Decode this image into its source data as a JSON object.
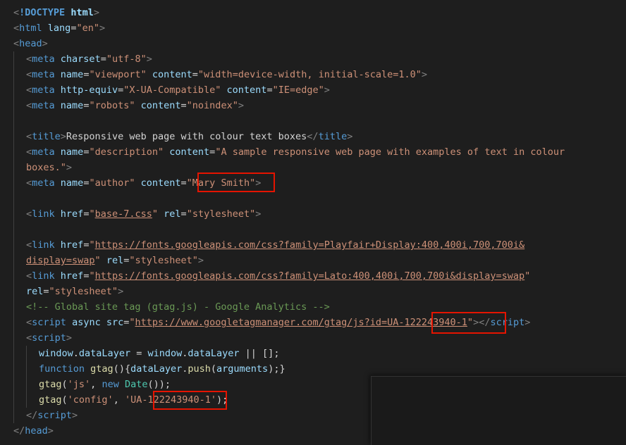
{
  "code": {
    "lines": [
      {
        "indent": 0,
        "tokens": [
          [
            "punc",
            "<"
          ],
          [
            "tag bold",
            "!DOCTYPE"
          ],
          [
            "txt",
            " "
          ],
          [
            "attr bold",
            "html"
          ],
          [
            "punc",
            ">"
          ]
        ]
      },
      {
        "indent": 0,
        "tokens": [
          [
            "punc",
            "<"
          ],
          [
            "tag",
            "html"
          ],
          [
            "txt",
            " "
          ],
          [
            "attr",
            "lang"
          ],
          [
            "txt",
            "="
          ],
          [
            "str",
            "\"en\""
          ],
          [
            "punc",
            ">"
          ]
        ]
      },
      {
        "indent": 0,
        "tokens": [
          [
            "punc",
            "<"
          ],
          [
            "tag",
            "head"
          ],
          [
            "punc",
            ">"
          ]
        ]
      },
      {
        "indent": 1,
        "tokens": [
          [
            "punc",
            "<"
          ],
          [
            "tag",
            "meta"
          ],
          [
            "txt",
            " "
          ],
          [
            "attr",
            "charset"
          ],
          [
            "txt",
            "="
          ],
          [
            "str",
            "\"utf-8\""
          ],
          [
            "punc",
            ">"
          ]
        ]
      },
      {
        "indent": 1,
        "tokens": [
          [
            "punc",
            "<"
          ],
          [
            "tag",
            "meta"
          ],
          [
            "txt",
            " "
          ],
          [
            "attr",
            "name"
          ],
          [
            "txt",
            "="
          ],
          [
            "str",
            "\"viewport\""
          ],
          [
            "txt",
            " "
          ],
          [
            "attr",
            "content"
          ],
          [
            "txt",
            "="
          ],
          [
            "str",
            "\"width=device-width, initial-scale=1.0\""
          ],
          [
            "punc",
            ">"
          ]
        ]
      },
      {
        "indent": 1,
        "tokens": [
          [
            "punc",
            "<"
          ],
          [
            "tag",
            "meta"
          ],
          [
            "txt",
            " "
          ],
          [
            "attr",
            "http-equiv"
          ],
          [
            "txt",
            "="
          ],
          [
            "str",
            "\"X-UA-Compatible\""
          ],
          [
            "txt",
            " "
          ],
          [
            "attr",
            "content"
          ],
          [
            "txt",
            "="
          ],
          [
            "str",
            "\"IE=edge\""
          ],
          [
            "punc",
            ">"
          ]
        ]
      },
      {
        "indent": 1,
        "tokens": [
          [
            "punc",
            "<"
          ],
          [
            "tag",
            "meta"
          ],
          [
            "txt",
            " "
          ],
          [
            "attr",
            "name"
          ],
          [
            "txt",
            "="
          ],
          [
            "str",
            "\"robots\""
          ],
          [
            "txt",
            " "
          ],
          [
            "attr",
            "content"
          ],
          [
            "txt",
            "="
          ],
          [
            "str",
            "\"noindex\""
          ],
          [
            "punc",
            ">"
          ]
        ]
      },
      {
        "indent": 1,
        "tokens": []
      },
      {
        "indent": 1,
        "tokens": [
          [
            "punc",
            "<"
          ],
          [
            "tag",
            "title"
          ],
          [
            "punc",
            ">"
          ],
          [
            "txt",
            "Responsive web page with colour text boxes"
          ],
          [
            "punc",
            "</"
          ],
          [
            "tag",
            "title"
          ],
          [
            "punc",
            ">"
          ]
        ]
      },
      {
        "indent": 1,
        "tokens": [
          [
            "punc",
            "<"
          ],
          [
            "tag",
            "meta"
          ],
          [
            "txt",
            " "
          ],
          [
            "attr",
            "name"
          ],
          [
            "txt",
            "="
          ],
          [
            "str",
            "\"description\""
          ],
          [
            "txt",
            " "
          ],
          [
            "attr",
            "content"
          ],
          [
            "txt",
            "="
          ],
          [
            "str",
            "\"A sample responsive web page with examples of text in colour"
          ]
        ]
      },
      {
        "indent": 1,
        "tokens": [
          [
            "str",
            "boxes.\""
          ],
          [
            "punc",
            ">"
          ]
        ]
      },
      {
        "indent": 1,
        "tokens": [
          [
            "punc",
            "<"
          ],
          [
            "tag",
            "meta"
          ],
          [
            "txt",
            " "
          ],
          [
            "attr",
            "name"
          ],
          [
            "txt",
            "="
          ],
          [
            "str",
            "\"author\""
          ],
          [
            "txt",
            " "
          ],
          [
            "attr",
            "content"
          ],
          [
            "txt",
            "="
          ],
          [
            "str",
            "\"Mary Smith\""
          ],
          [
            "punc",
            ">"
          ]
        ]
      },
      {
        "indent": 1,
        "tokens": []
      },
      {
        "indent": 1,
        "tokens": [
          [
            "punc",
            "<"
          ],
          [
            "tag",
            "link"
          ],
          [
            "txt",
            " "
          ],
          [
            "attr",
            "href"
          ],
          [
            "txt",
            "="
          ],
          [
            "str",
            "\""
          ],
          [
            "str link",
            "base-7.css"
          ],
          [
            "str",
            "\""
          ],
          [
            "txt",
            " "
          ],
          [
            "attr",
            "rel"
          ],
          [
            "txt",
            "="
          ],
          [
            "str",
            "\"stylesheet\""
          ],
          [
            "punc",
            ">"
          ]
        ]
      },
      {
        "indent": 1,
        "tokens": []
      },
      {
        "indent": 1,
        "tokens": [
          [
            "punc",
            "<"
          ],
          [
            "tag",
            "link"
          ],
          [
            "txt",
            " "
          ],
          [
            "attr",
            "href"
          ],
          [
            "txt",
            "="
          ],
          [
            "str",
            "\""
          ],
          [
            "str link",
            "https://fonts.googleapis.com/css?family=Playfair+Display:400,400i,700,700i&"
          ]
        ]
      },
      {
        "indent": 1,
        "tokens": [
          [
            "str link",
            "display=swap"
          ],
          [
            "str",
            "\""
          ],
          [
            "txt",
            " "
          ],
          [
            "attr",
            "rel"
          ],
          [
            "txt",
            "="
          ],
          [
            "str",
            "\"stylesheet\""
          ],
          [
            "punc",
            ">"
          ]
        ]
      },
      {
        "indent": 1,
        "tokens": [
          [
            "punc",
            "<"
          ],
          [
            "tag",
            "link"
          ],
          [
            "txt",
            " "
          ],
          [
            "attr",
            "href"
          ],
          [
            "txt",
            "="
          ],
          [
            "str",
            "\""
          ],
          [
            "str link",
            "https://fonts.googleapis.com/css?family=Lato:400,400i,700,700i&display=swap"
          ],
          [
            "str",
            "\""
          ]
        ]
      },
      {
        "indent": 1,
        "tokens": [
          [
            "attr",
            "rel"
          ],
          [
            "txt",
            "="
          ],
          [
            "str",
            "\"stylesheet\""
          ],
          [
            "punc",
            ">"
          ]
        ]
      },
      {
        "indent": 1,
        "tokens": [
          [
            "com",
            "<!-- Global site tag (gtag.js) - Google Analytics -->"
          ]
        ]
      },
      {
        "indent": 1,
        "tokens": [
          [
            "punc",
            "<"
          ],
          [
            "tag",
            "script"
          ],
          [
            "txt",
            " "
          ],
          [
            "attr",
            "async"
          ],
          [
            "txt",
            " "
          ],
          [
            "attr",
            "src"
          ],
          [
            "txt",
            "="
          ],
          [
            "str",
            "\""
          ],
          [
            "str link",
            "https://www.googletagmanager.com/gtag/js?id=UA-122243940-1"
          ],
          [
            "str",
            "\""
          ],
          [
            "punc",
            "></"
          ],
          [
            "tag",
            "script"
          ],
          [
            "punc",
            ">"
          ]
        ]
      },
      {
        "indent": 1,
        "tokens": [
          [
            "punc",
            "<"
          ],
          [
            "tag",
            "script"
          ],
          [
            "punc",
            ">"
          ]
        ]
      },
      {
        "indent": 2,
        "tokens": [
          [
            "var",
            "window"
          ],
          [
            "txt",
            "."
          ],
          [
            "var",
            "dataLayer"
          ],
          [
            "txt",
            " = "
          ],
          [
            "var",
            "window"
          ],
          [
            "txt",
            "."
          ],
          [
            "var",
            "dataLayer"
          ],
          [
            "txt",
            " || [];"
          ]
        ]
      },
      {
        "indent": 2,
        "tokens": [
          [
            "kw",
            "function"
          ],
          [
            "txt",
            " "
          ],
          [
            "fn",
            "gtag"
          ],
          [
            "txt",
            "(){"
          ],
          [
            "var",
            "dataLayer"
          ],
          [
            "txt",
            "."
          ],
          [
            "fn",
            "push"
          ],
          [
            "txt",
            "("
          ],
          [
            "var",
            "arguments"
          ],
          [
            "txt",
            ");}"
          ]
        ]
      },
      {
        "indent": 2,
        "tokens": [
          [
            "fn",
            "gtag"
          ],
          [
            "txt",
            "("
          ],
          [
            "str",
            "'js'"
          ],
          [
            "txt",
            ", "
          ],
          [
            "kw",
            "new"
          ],
          [
            "txt",
            " "
          ],
          [
            "cls",
            "Date"
          ],
          [
            "txt",
            "());"
          ]
        ]
      },
      {
        "indent": 2,
        "tokens": [
          [
            "fn",
            "gtag"
          ],
          [
            "txt",
            "("
          ],
          [
            "str",
            "'config'"
          ],
          [
            "txt",
            ", "
          ],
          [
            "str",
            "'UA-122243940-1'"
          ],
          [
            "txt",
            ");"
          ]
        ]
      },
      {
        "indent": 1,
        "tokens": [
          [
            "punc",
            "</"
          ],
          [
            "tag",
            "script"
          ],
          [
            "punc",
            ">"
          ]
        ]
      },
      {
        "indent": 0,
        "tokens": [
          [
            "punc",
            "</"
          ],
          [
            "tag",
            "head"
          ],
          [
            "punc",
            ">"
          ]
        ]
      }
    ]
  }
}
